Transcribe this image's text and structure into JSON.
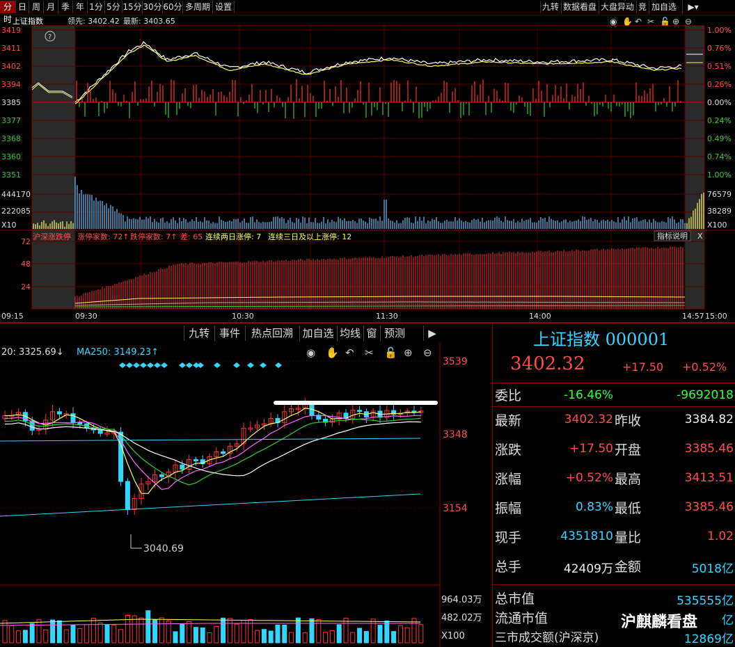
{
  "toolbar": {
    "tabs": [
      "分时",
      "日",
      "周",
      "月",
      "季",
      "年",
      "1分",
      "5分",
      "15分",
      "30分",
      "60分",
      "多周期",
      "设置"
    ],
    "right_tabs": [
      "九转",
      "数据看盘",
      "大盘异动",
      "竞",
      "加自选"
    ]
  },
  "intraday": {
    "header": {
      "name": "上证指数",
      "leader_label": "领先:",
      "leader": "3402.42",
      "latest_label": "最新:",
      "latest": "3403.65"
    },
    "help_icon": "?",
    "price_ticks": [
      "3419",
      "3411",
      "3402",
      "3394",
      "3385",
      "3377",
      "3368",
      "3360",
      "3351"
    ],
    "pct_ticks": [
      "1.00%",
      "0.76%",
      "0.51%",
      "0.26%",
      "0.00%",
      "0.24%",
      "0.49%",
      "0.74%",
      "1.00%"
    ],
    "volume_ticks_left": [
      "444170",
      "222085",
      "X10"
    ],
    "volume_ticks_right": [
      "76579",
      "38289",
      "X100"
    ],
    "time_ticks": [
      "09:15",
      "09:30",
      "10:30",
      "11:30",
      "14:00",
      "14:57",
      "15:00"
    ],
    "limit_header": {
      "label": "沪深涨跌停",
      "up_label": "涨停家数:",
      "up": "72↑",
      "down_label": "跌停家数:",
      "down": "7↑",
      "diff_label": "差:",
      "diff": "65",
      "two_day_label": "连续两日涨停:",
      "two_day": "7",
      "three_day_label": "连续三日及以上涨停:",
      "three_day": "12"
    },
    "limit_ticks": [
      "72",
      "48",
      "24"
    ],
    "indicator_btn": "指标说明",
    "close_x": "X"
  },
  "kline_toolbar": [
    "九转",
    "事件",
    "热点回溯",
    "加自选",
    "均线",
    "窗",
    "预测"
  ],
  "kline": {
    "ma_label_1": "20: 3325.69↓",
    "ma_label_2": "MA250: 3149.23↑",
    "price_ticks": [
      "3539",
      "3348",
      "3154"
    ],
    "low_label": "3040.69",
    "vol_ticks": [
      "964.03万",
      "482.02万",
      "X100"
    ]
  },
  "quote": {
    "title": "上证指数 000001",
    "price": "3402.32",
    "change": "+17.50",
    "change_pct": "+0.52%",
    "weibi_label": "委比",
    "weibi": "-16.46%",
    "weicha": "-9692018",
    "rows": [
      {
        "l1": "最新",
        "v1": "3402.32",
        "c1": "red",
        "l2": "昨收",
        "v2": "3384.82",
        "c2": "white"
      },
      {
        "l1": "涨跌",
        "v1": "+17.50",
        "c1": "red",
        "l2": "开盘",
        "v2": "3385.46",
        "c2": "red"
      },
      {
        "l1": "涨幅",
        "v1": "+0.52%",
        "c1": "red",
        "l2": "最高",
        "v2": "3413.51",
        "c2": "red"
      },
      {
        "l1": "振幅",
        "v1": "0.83%",
        "c1": "cyan",
        "l2": "最低",
        "v2": "3385.46",
        "c2": "red"
      },
      {
        "l1": "现手",
        "v1": "4351810",
        "c1": "cyan",
        "l2": "量比",
        "v2": "1.02",
        "c2": "red"
      },
      {
        "l1": "总手",
        "v1": "42409万",
        "c1": "white",
        "l2": "金额",
        "v2": "5018亿",
        "c2": "cyan"
      }
    ],
    "mktcap_label": "总市值",
    "mktcap": "535555亿",
    "float_label": "流通市值",
    "float": "亿",
    "turnover_label": "三市成交额(沪深京)",
    "turnover": "12869亿",
    "watermark": "沪麒麟看盘"
  },
  "colors": {
    "up": "#ff3333",
    "down": "#33cc33",
    "grid": "#5a0000",
    "price_line": "#ffffff",
    "avg_line": "#ffff66",
    "cyan": "#33d6ff"
  },
  "chart_data": {
    "type": "line",
    "title": "上证指数",
    "x": [
      "09:30",
      "10:30",
      "11:30",
      "14:00",
      "15:00"
    ],
    "series": [
      {
        "values": [
          3385,
          3410,
          3402,
          3404,
          3402
        ]
      },
      {
        "values": [
          3385,
          3408,
          3401,
          3403,
          3402
        ]
      }
    ],
    "ylim": [
      3351,
      3419
    ],
    "grid": true
  }
}
